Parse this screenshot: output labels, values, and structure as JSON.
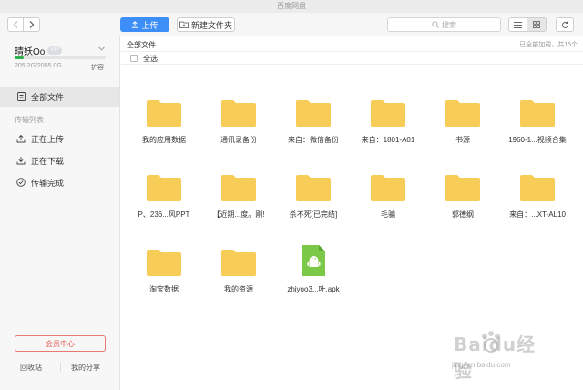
{
  "window": {
    "title": "百度网盘"
  },
  "toolbar": {
    "upload_label": "上传",
    "new_folder_label": "新建文件夹",
    "search_placeholder": "搜索"
  },
  "sidebar": {
    "username": "晴妖Oo",
    "vip_badge": "VIP",
    "quota_text": "205.2G/2055.0G",
    "quota_used_fraction": 0.1,
    "expand_label": "扩容",
    "all_files": "全部文件",
    "transfer_section": "传输列表",
    "uploading": "正在上传",
    "downloading": "正在下载",
    "completed": "传输完成",
    "member_center": "会员中心",
    "recycle_bin": "回收站",
    "my_shares": "我的分享"
  },
  "main": {
    "breadcrumb": "全部文件",
    "loaded_text": "已全部加载，共15个",
    "select_all": "全选",
    "items": [
      {
        "name": "我的应用数据",
        "type": "folder"
      },
      {
        "name": "通讯录备份",
        "type": "folder"
      },
      {
        "name": "来自：微信备份",
        "type": "folder"
      },
      {
        "name": "来自：1801-A01",
        "type": "folder"
      },
      {
        "name": "书源",
        "type": "folder"
      },
      {
        "name": "1960-1...视频合集",
        "type": "folder"
      },
      {
        "name": "P、236...风PPT",
        "type": "folder"
      },
      {
        "name": "【近期...度。刚!",
        "type": "folder"
      },
      {
        "name": "杀不死[已完结]",
        "type": "folder"
      },
      {
        "name": "毛骗",
        "type": "folder"
      },
      {
        "name": "郭德纲",
        "type": "folder"
      },
      {
        "name": "来自：...XT-AL10",
        "type": "folder"
      },
      {
        "name": "淘宝数据",
        "type": "folder"
      },
      {
        "name": "我的资源",
        "type": "folder"
      },
      {
        "name": "zhiyoo3...叶.apk",
        "type": "apk"
      }
    ]
  },
  "watermark": {
    "brand": "Baidu经验",
    "url": "jingyan.baidu.com"
  },
  "colors": {
    "accent": "#3e8ef7",
    "folder": "#f8cd57",
    "apk": "#7cc94a",
    "quota": "#2fb34a",
    "vip": "#e05a4f"
  }
}
